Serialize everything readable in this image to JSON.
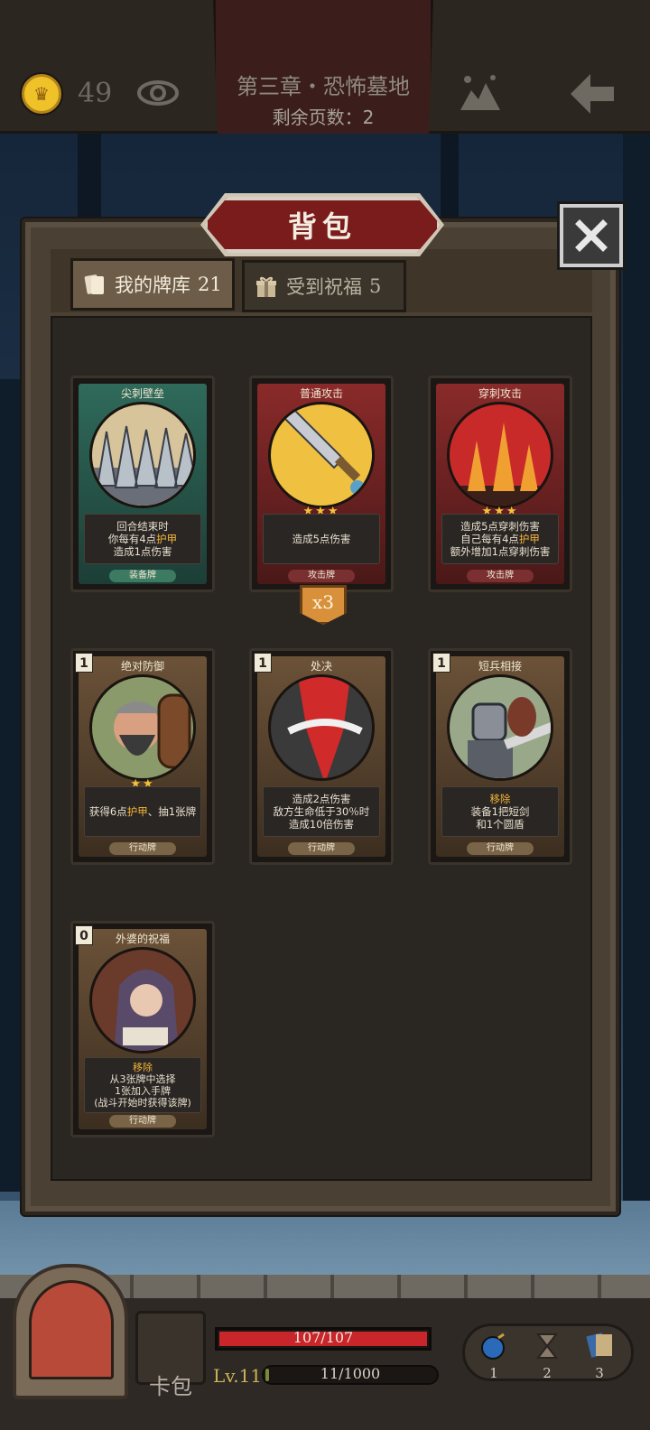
{
  "top_bar": {
    "coins": "49",
    "chapter_title": "第三章・恐怖墓地",
    "pages_left": "剩余页数：2"
  },
  "panel": {
    "title": "背包",
    "tabs": [
      {
        "label": "我的牌库",
        "count": "21"
      },
      {
        "label": "受到祝福",
        "count": "5"
      }
    ]
  },
  "cards": [
    {
      "name": "尖刺壁垒",
      "lines": [
        "回合结束时",
        "你每有4点护甲",
        "造成1点伤害"
      ],
      "type": "装备牌",
      "stars": ""
    },
    {
      "name": "普通攻击",
      "lines": [
        "造成5点伤害"
      ],
      "type": "攻击牌",
      "stars": "★★★",
      "badge": "x3"
    },
    {
      "name": "穿刺攻击",
      "lines": [
        "造成5点穿刺伤害",
        "自己每有4点护甲",
        "额外增加1点穿刺伤害"
      ],
      "type": "攻击牌",
      "stars": "★★★"
    },
    {
      "name": "绝对防御",
      "cost": "1",
      "lines": [
        "获得6点护甲、抽1张牌"
      ],
      "type": "行动牌",
      "stars": "★★"
    },
    {
      "name": "处决",
      "cost": "1",
      "lines": [
        "造成2点伤害",
        "敌方生命低于30％时",
        "造成10倍伤害"
      ],
      "type": "行动牌",
      "stars": ""
    },
    {
      "name": "短兵相接",
      "cost": "1",
      "lines": [
        "移除",
        "装备1把短剑",
        "和1个圆盾"
      ],
      "type": "行动牌",
      "stars": ""
    },
    {
      "name": "外婆的祝福",
      "cost": "0",
      "lines": [
        "移除",
        "从3张牌中选择",
        "1张加入手牌",
        "(战斗开始时获得该牌)"
      ],
      "type": "行动牌",
      "stars": ""
    }
  ],
  "hud": {
    "deck_label": "卡包",
    "hp_text": "107/107",
    "hp_fraction": 1.0,
    "level": "Lv.11",
    "xp_text": "11/1000",
    "xp_fraction": 0.011,
    "slots": [
      "1",
      "2",
      "3"
    ]
  },
  "colors": {
    "hp": "#c8262a",
    "highlight": "#f2b43a",
    "title_banner": "#7a1c1c"
  },
  "icons": [
    "crown-coin-icon",
    "eye-icon",
    "map-icon",
    "back-arrow-icon",
    "close-icon",
    "cards-icon",
    "gift-icon",
    "bomb-icon",
    "hourglass-icon",
    "card-slot-icon"
  ]
}
